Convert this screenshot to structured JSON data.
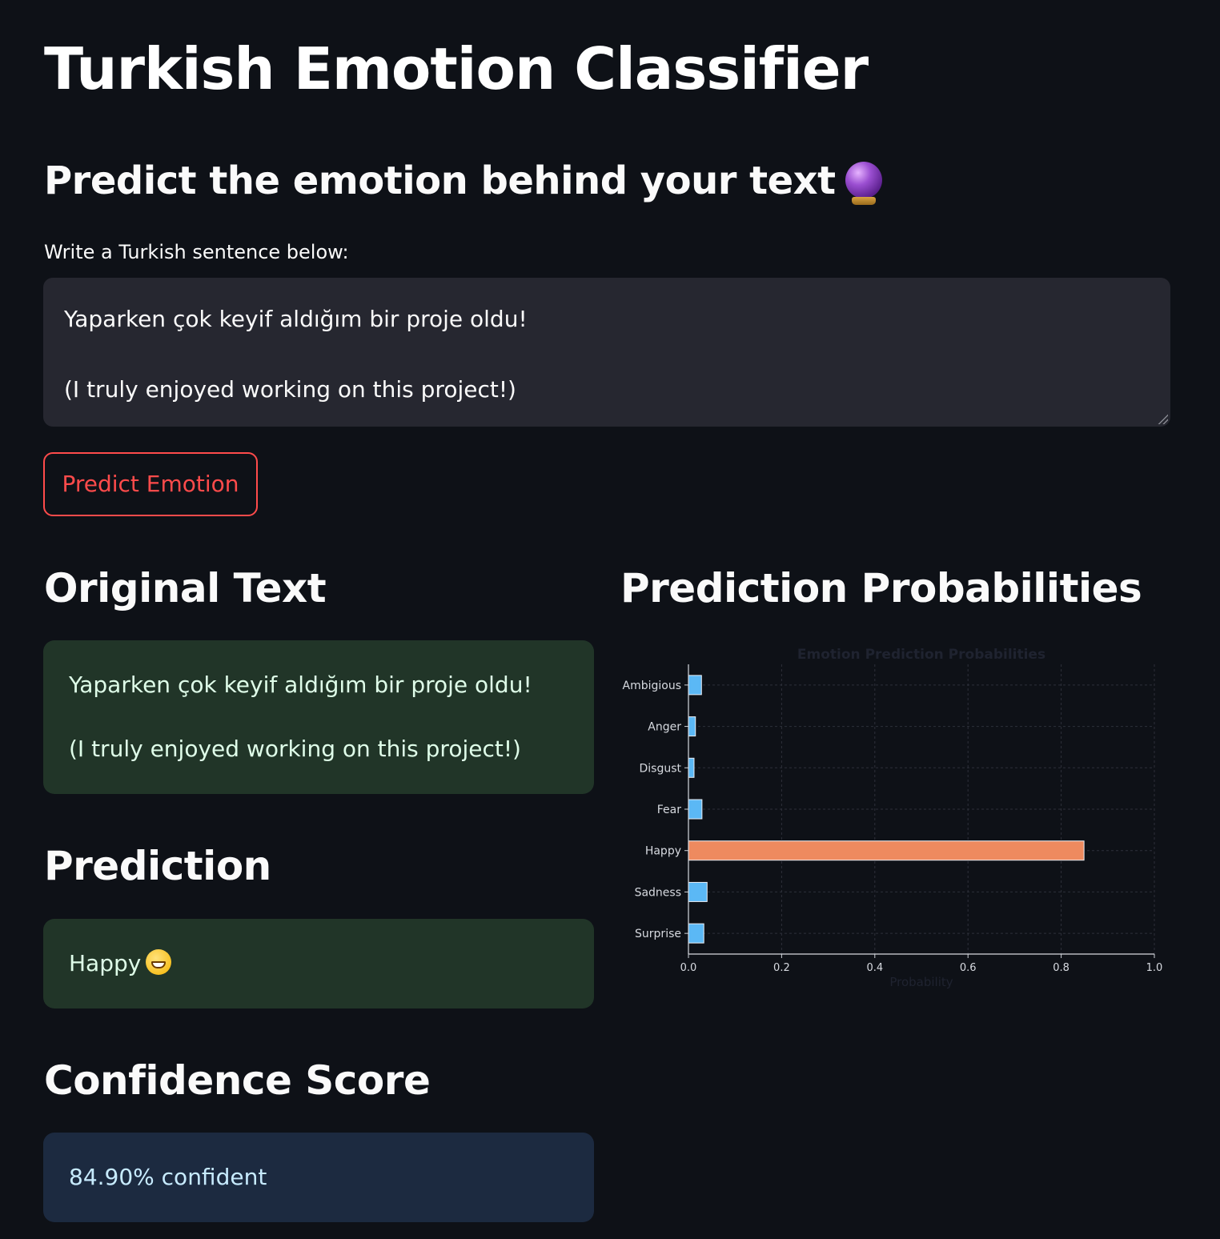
{
  "header": {
    "title": "Turkish Emotion Classifier",
    "subtitle": "Predict the emotion behind your text"
  },
  "input": {
    "label": "Write a Turkish sentence below:",
    "value": "Yaparken çok keyif aldığım bir proje oldu!\n\n(I truly enjoyed working on this project!)"
  },
  "button": {
    "predict_label": "Predict Emotion"
  },
  "original": {
    "heading": "Original Text",
    "line1": "Yaparken çok keyif aldığım bir proje oldu!",
    "line2": "(I truly enjoyed working on this project!)"
  },
  "prediction": {
    "heading": "Prediction",
    "value": "Happy"
  },
  "confidence": {
    "heading": "Confidence Score",
    "value": "84.90% confident"
  },
  "probabilities": {
    "heading": "Prediction Probabilities"
  },
  "colors": {
    "background": "#0e1117",
    "accent": "#ff4b4b",
    "success_bg": "#213528",
    "info_bg": "#1c2a40",
    "bar_default": "#5bb8f5",
    "bar_highlight": "#ee8a5f"
  },
  "chart_data": {
    "type": "bar",
    "orientation": "horizontal",
    "title": "Emotion Prediction Probabilities",
    "xlabel": "Probability",
    "ylabel": "",
    "categories": [
      "Ambigious",
      "Anger",
      "Disgust",
      "Fear",
      "Happy",
      "Sadness",
      "Surprise"
    ],
    "values": [
      0.028,
      0.015,
      0.012,
      0.029,
      0.849,
      0.04,
      0.033
    ],
    "highlight": "Happy",
    "xlim": [
      0.0,
      1.0
    ],
    "xticks": [
      "0.0",
      "0.2",
      "0.4",
      "0.6",
      "0.8",
      "1.0"
    ],
    "grid": true
  }
}
